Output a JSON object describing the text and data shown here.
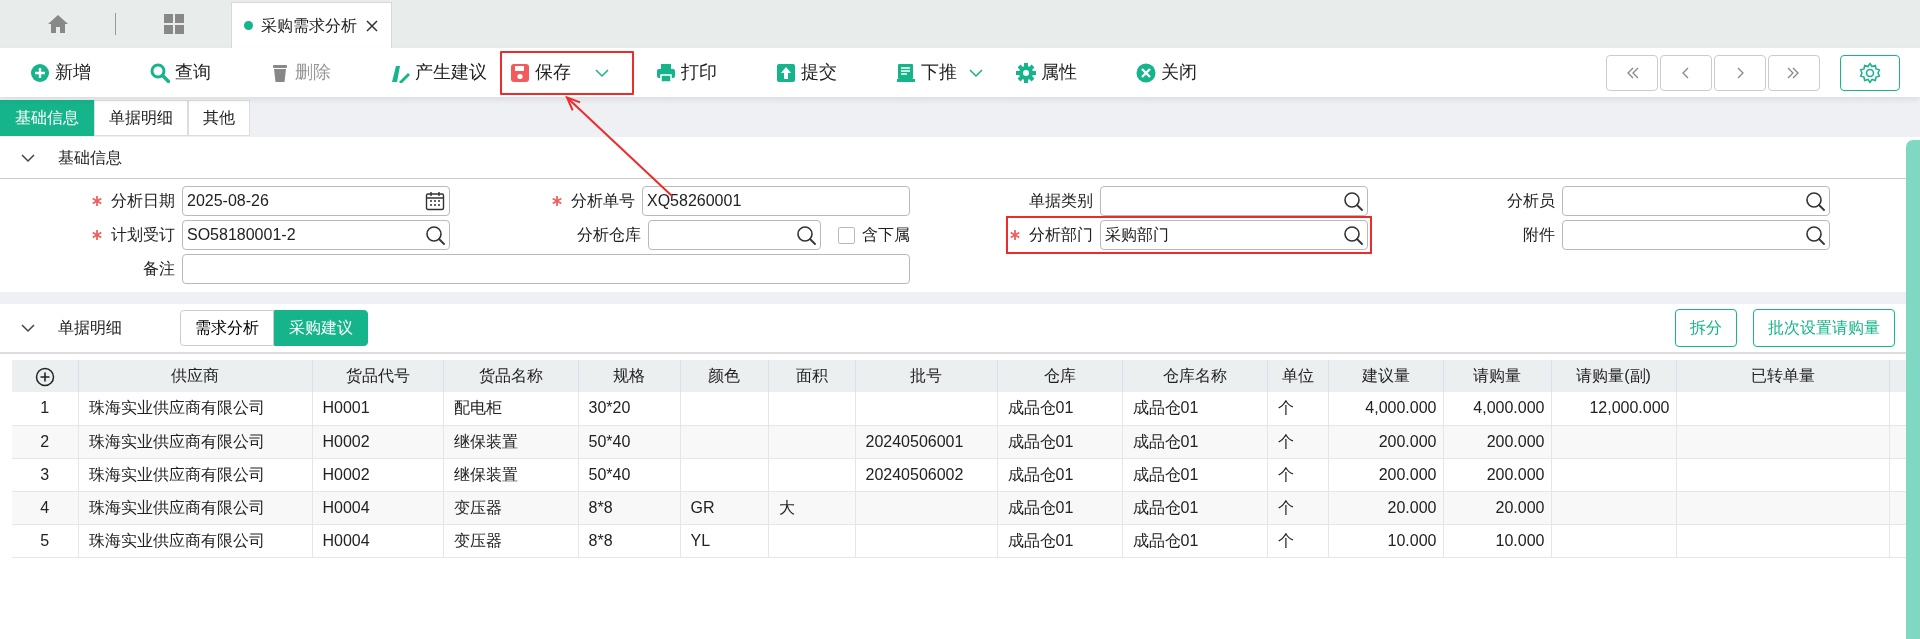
{
  "top_tabs": [
    {
      "kind": "home",
      "selected": false
    },
    {
      "kind": "apps",
      "selected": false
    },
    {
      "kind": "document",
      "label": "采购需求分析",
      "selected": true,
      "closable": true
    }
  ],
  "toolbar": {
    "buttons": [
      {
        "kind": "add",
        "label": "新增",
        "disabled": false,
        "dropdown": false,
        "highlighted": false
      },
      {
        "kind": "search",
        "label": "查询",
        "disabled": false,
        "dropdown": false,
        "highlighted": false
      },
      {
        "kind": "delete",
        "label": "删除",
        "disabled": true,
        "dropdown": false,
        "highlighted": false
      },
      {
        "kind": "generate",
        "label": "产生建议",
        "disabled": false,
        "dropdown": false,
        "highlighted": false
      },
      {
        "kind": "save",
        "label": "保存",
        "disabled": false,
        "dropdown": true,
        "highlighted": true
      },
      {
        "kind": "print",
        "label": "打印",
        "disabled": false,
        "dropdown": false,
        "highlighted": false
      },
      {
        "kind": "submit",
        "label": "提交",
        "disabled": false,
        "dropdown": false,
        "highlighted": false
      },
      {
        "kind": "push",
        "label": "下推",
        "disabled": false,
        "dropdown": true,
        "highlighted": false
      },
      {
        "kind": "properties",
        "label": "属性",
        "disabled": false,
        "dropdown": false,
        "highlighted": false
      },
      {
        "kind": "close",
        "label": "关闭",
        "disabled": false,
        "dropdown": false,
        "highlighted": false
      }
    ]
  },
  "section_tabs": [
    {
      "label": "基础信息",
      "selected": true
    },
    {
      "label": "单据明细",
      "selected": false
    },
    {
      "label": "其他",
      "selected": false
    }
  ],
  "basic_info": {
    "title": "基础信息",
    "expanded": true,
    "fields": [
      {
        "label": "分析日期",
        "required": true,
        "kind": "date",
        "value": "2025-08-26",
        "highlighted": false,
        "callout": false
      },
      {
        "label": "分析单号",
        "required": true,
        "kind": "text",
        "value": "XQ58260001",
        "highlighted": false,
        "callout": true
      },
      {
        "label": "单据类别",
        "required": false,
        "kind": "lookup",
        "highlighted": false,
        "callout": false
      },
      {
        "label": "分析员",
        "required": false,
        "kind": "lookup",
        "highlighted": false,
        "callout": false
      },
      {
        "label": "计划受订",
        "required": true,
        "kind": "lookup",
        "value": "SO58180001-2",
        "highlighted": false,
        "callout": false
      },
      {
        "label": "分析仓库",
        "required": false,
        "kind": "lookup",
        "highlighted": false,
        "callout": false,
        "checkbox": {
          "label": "含下属",
          "checked": false
        }
      },
      {
        "label": "分析部门",
        "required": true,
        "kind": "lookup",
        "value": "采购部门",
        "highlighted": true,
        "callout": false
      },
      {
        "label": "附件",
        "required": false,
        "kind": "lookup",
        "highlighted": false,
        "callout": false
      },
      {
        "label": "备注",
        "required": false,
        "kind": "wide",
        "highlighted": false,
        "callout": false
      }
    ]
  },
  "detail": {
    "title": "单据明细",
    "expanded": true,
    "tabs": [
      {
        "label": "需求分析",
        "selected": false
      },
      {
        "label": "采购建议",
        "selected": true
      }
    ],
    "buttons": [
      "拆分",
      "批次设置请购量"
    ],
    "table": {
      "columns": [
        {
          "kind": "index"
        },
        {
          "label": "供应商",
          "kind": "text"
        },
        {
          "label": "货品代号",
          "kind": "text"
        },
        {
          "label": "货品名称",
          "kind": "text"
        },
        {
          "label": "规格",
          "kind": "text"
        },
        {
          "label": "颜色",
          "kind": "text"
        },
        {
          "label": "面积",
          "kind": "text"
        },
        {
          "label": "批号",
          "kind": "text"
        },
        {
          "label": "仓库",
          "kind": "text"
        },
        {
          "label": "仓库名称",
          "kind": "text"
        },
        {
          "label": "单位",
          "kind": "text"
        },
        {
          "label": "建议量",
          "kind": "number"
        },
        {
          "label": "请购量",
          "kind": "number"
        },
        {
          "label": "请购量(副)",
          "kind": "number"
        },
        {
          "label": "已转单量",
          "kind": "number"
        }
      ],
      "rows": [
        [
          "1",
          "珠海实业供应商有限公司",
          "H0001",
          "配电柜",
          "30*20",
          null,
          null,
          null,
          "成品仓01",
          "成品仓01",
          "个",
          "4,000.000",
          "4,000.000",
          "12,000.000",
          null
        ],
        [
          "2",
          "珠海实业供应商有限公司",
          "H0002",
          "继保装置",
          "50*40",
          null,
          null,
          "20240506001",
          "成品仓01",
          "成品仓01",
          "个",
          "200.000",
          "200.000",
          null,
          null
        ],
        [
          "3",
          "珠海实业供应商有限公司",
          "H0002",
          "继保装置",
          "50*40",
          null,
          null,
          "20240506002",
          "成品仓01",
          "成品仓01",
          "个",
          "200.000",
          "200.000",
          null,
          null
        ],
        [
          "4",
          "珠海实业供应商有限公司",
          "H0004",
          "变压器",
          "8*8",
          "GR",
          "大",
          null,
          "成品仓01",
          "成品仓01",
          "个",
          "20.000",
          "20.000",
          null,
          null
        ],
        [
          "5",
          "珠海实业供应商有限公司",
          "H0004",
          "变压器",
          "8*8",
          "YL",
          null,
          null,
          "成品仓01",
          "成品仓01",
          "个",
          "10.000",
          "10.000",
          null,
          null
        ]
      ]
    }
  }
}
